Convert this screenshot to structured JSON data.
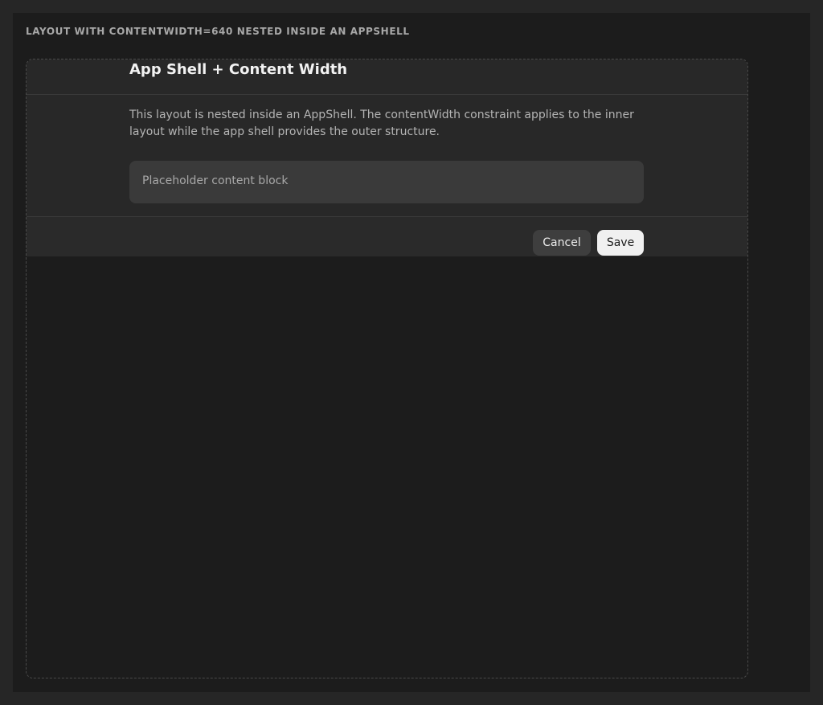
{
  "section": {
    "label": "LAYOUT WITH CONTENTWIDTH=640 NESTED INSIDE AN APPSHELL"
  },
  "layout": {
    "title": "App Shell + Content Width",
    "description": "This layout is nested inside an AppShell. The contentWidth constraint applies to the inner layout while the app shell provides the outer structure.",
    "content_block_label": "Placeholder content block"
  },
  "footer": {
    "cancel_label": "Cancel",
    "save_label": "Save"
  }
}
